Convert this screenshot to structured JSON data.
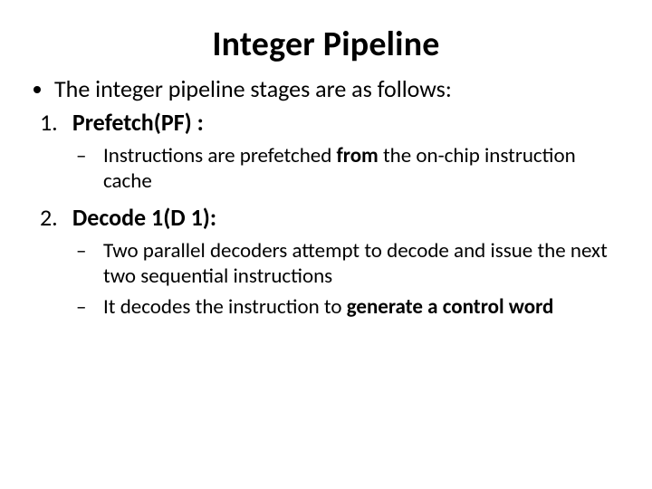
{
  "title": "Integer Pipeline",
  "intro": "The integer pipeline stages are as follows:",
  "stages": [
    {
      "num": "1.",
      "label": "Prefetch(PF) :",
      "sub": [
        {
          "pre": "Instructions are prefetched ",
          "bold": "from",
          "post": " the on-chip instruction cache"
        }
      ]
    },
    {
      "num": "2.",
      "label": "Decode 1(D 1):",
      "sub": [
        {
          "pre": "Two parallel decoders attempt to decode and issue the next two sequential instructions",
          "bold": "",
          "post": ""
        },
        {
          "pre": "It decodes the instruction to ",
          "bold": "generate a control word",
          "post": ""
        }
      ]
    }
  ]
}
